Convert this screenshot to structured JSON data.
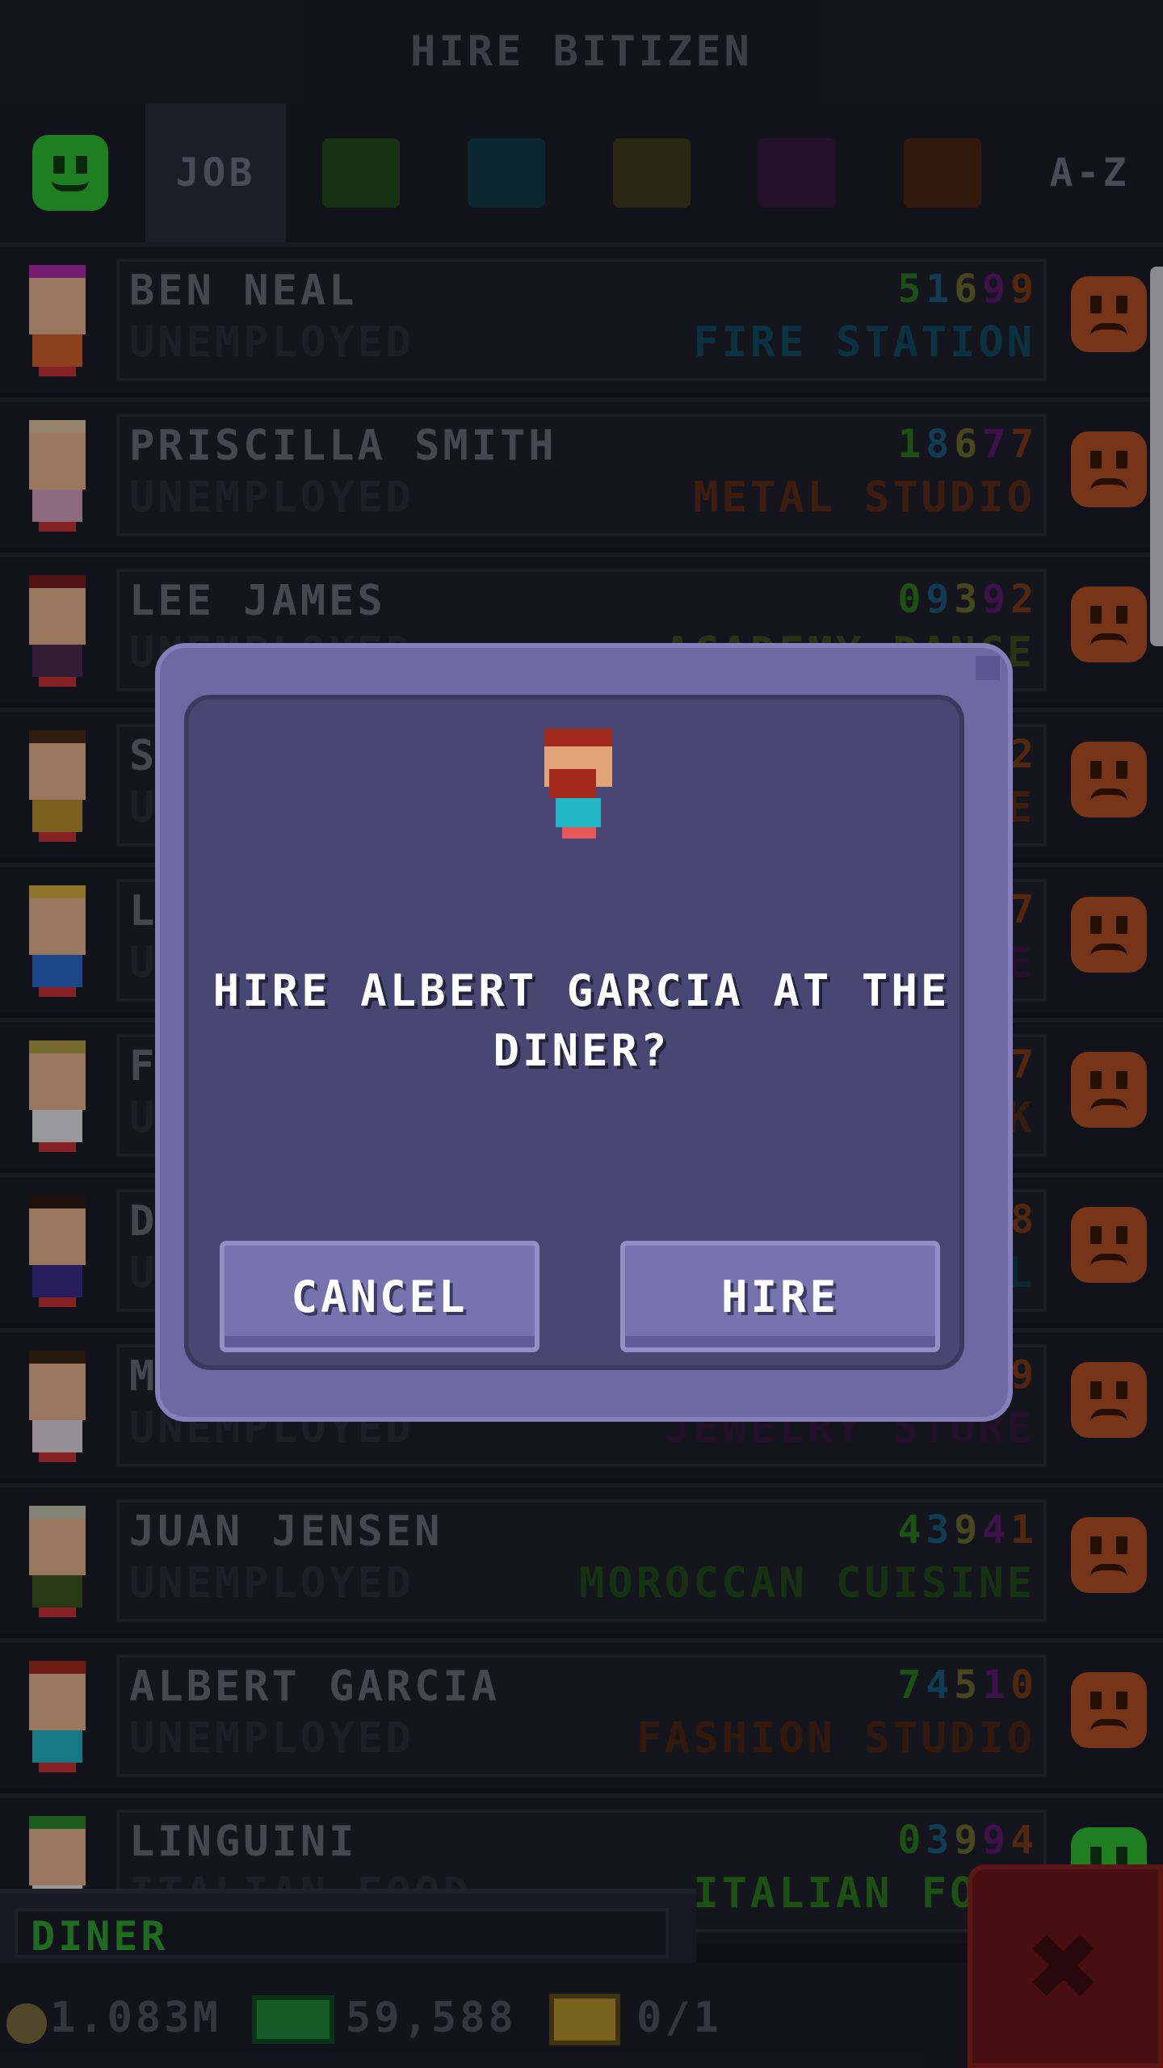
{
  "header": {
    "title": "HIRE BITIZEN"
  },
  "filters": {
    "smiley_icon": "smiley-icon",
    "job_label": "JOB",
    "az_label": "A-Z",
    "swatches": [
      "#1f4a18",
      "#0f3a44",
      "#3d3d18",
      "#33163a",
      "#4a2410"
    ]
  },
  "rows": [
    {
      "name": "BEN NEAL",
      "status": "UNEMPLOYED",
      "stats": [
        "5",
        "1",
        "6",
        "9",
        "9"
      ],
      "dream": "FIRE STATION",
      "dream_color": "#0f4a5e",
      "mood": "sad",
      "hair": "#b02aa8",
      "body": "#d6602a"
    },
    {
      "name": "PRISCILLA SMITH",
      "status": "UNEMPLOYED",
      "stats": [
        "1",
        "8",
        "6",
        "7",
        "7"
      ],
      "dream": "METAL STUDIO",
      "dream_color": "#5a2a12",
      "mood": "sad",
      "hair": "#e0c8a0",
      "body": "#d8a0c0"
    },
    {
      "name": "LEE JAMES",
      "status": "UNEMPLOYED",
      "stats": [
        "0",
        "9",
        "3",
        "9",
        "2"
      ],
      "dream": "ACADEMY DANCE",
      "dream_color": "#3d4a18",
      "mood": "sad",
      "hair": "#7a1a1a",
      "body": "#4a2a4a"
    },
    {
      "name": "SAM",
      "status": "UNEMPLOYED",
      "stats": [
        "",
        "",
        "",
        "",
        "2"
      ],
      "dream": "E",
      "dream_color": "#5a2a12",
      "mood": "sad",
      "hair": "#4a2a18",
      "body": "#b8902a"
    },
    {
      "name": "LUCY",
      "status": "UNEMPLOYED",
      "stats": [
        "",
        "",
        "",
        "",
        "7"
      ],
      "dream": "E",
      "dream_color": "#33163a",
      "mood": "sad",
      "hair": "#d8b040",
      "body": "#2a6ad0"
    },
    {
      "name": "FRED",
      "status": "UNEMPLOYED",
      "stats": [
        "",
        "",
        "",
        "",
        "7"
      ],
      "dream": "K",
      "dream_color": "#4a2a12",
      "mood": "sad",
      "hair": "#b0a040",
      "body": "#e8e8e8"
    },
    {
      "name": "DAN",
      "status": "UNEMPLOYED",
      "stats": [
        "",
        "",
        "",
        "",
        "8"
      ],
      "dream": "L",
      "dream_color": "#0f3a44",
      "mood": "sad",
      "hair": "#2a1a10",
      "body": "#3a2a8a"
    },
    {
      "name": "MARY",
      "status": "UNEMPLOYED",
      "stats": [
        "",
        "",
        "",
        "",
        "9"
      ],
      "dream": "JEWELRY STORE",
      "dream_color": "#33163a",
      "mood": "sad",
      "hair": "#3a2410",
      "body": "#e0d8e0"
    },
    {
      "name": "JUAN JENSEN",
      "status": "UNEMPLOYED",
      "stats": [
        "4",
        "3",
        "9",
        "4",
        "1"
      ],
      "dream": "MOROCCAN CUISINE",
      "dream_color": "#1f4a18",
      "mood": "sad",
      "hair": "#c8c8b0",
      "body": "#3a5a1a"
    },
    {
      "name": "ALBERT GARCIA",
      "status": "UNEMPLOYED",
      "stats": [
        "7",
        "4",
        "5",
        "1",
        "0"
      ],
      "dream": "FASHION STUDIO",
      "dream_color": "#4a2410",
      "mood": "sad",
      "hair": "#a22a1c",
      "body": "#22b7c7"
    },
    {
      "name": "LINGUINI",
      "status": "ITALIAN FOOD",
      "stats": [
        "0",
        "3",
        "9",
        "9",
        "4"
      ],
      "dream": "ITALIAN FOOD",
      "dream_color": "#2a7a1a",
      "mood": "happy",
      "hair": "#2a8a2a",
      "body": "#e8e8e8"
    }
  ],
  "stat_colors": [
    "#2a7a1a",
    "#1a5a7a",
    "#6a6a2a",
    "#5a1a6a",
    "#7a3a12"
  ],
  "dialog": {
    "message": "HIRE ALBERT GARCIA AT THE DINER?",
    "cancel_label": "CANCEL",
    "hire_label": "HIRE"
  },
  "bottom": {
    "job_field": "DINER",
    "coins": "1.083M",
    "bux": "59,588",
    "chests": "0/1",
    "close_symbol": "✖"
  }
}
